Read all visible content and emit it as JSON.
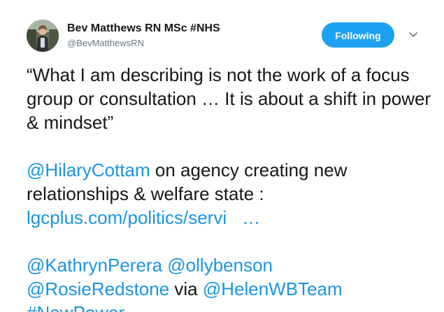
{
  "user": {
    "display_name": "Bev Matthews RN MSc #NHS",
    "handle": "@BevMatthewsRN"
  },
  "follow_button": {
    "label": "Following"
  },
  "tweet": {
    "quote": "“What I am describing is not the work of a focus group or consultation … It is about a shift in power & mindset”",
    "mention_hilary": "@HilaryCottam",
    "text_agency_1": " on agency creating new",
    "text_agency_2": "relationships & welfare state :",
    "url_text": "lgcplus.com/politics/servi",
    "url_ellipsis": "…",
    "mention_kathryn": "@KathrynPerera",
    "mention_olly": "@ollybenson",
    "mention_rosie": "@RosieRedstone",
    "text_via": " via ",
    "mention_helen": "@HelenWBTeam",
    "hashtag_newpower": "#NewPower"
  },
  "icons": {
    "avatar": "profile-photo",
    "menu": "chevron-down-icon"
  },
  "colors": {
    "link": "#1b95e0",
    "button": "#1da1f2",
    "text": "#14171a",
    "handle": "#657786"
  }
}
